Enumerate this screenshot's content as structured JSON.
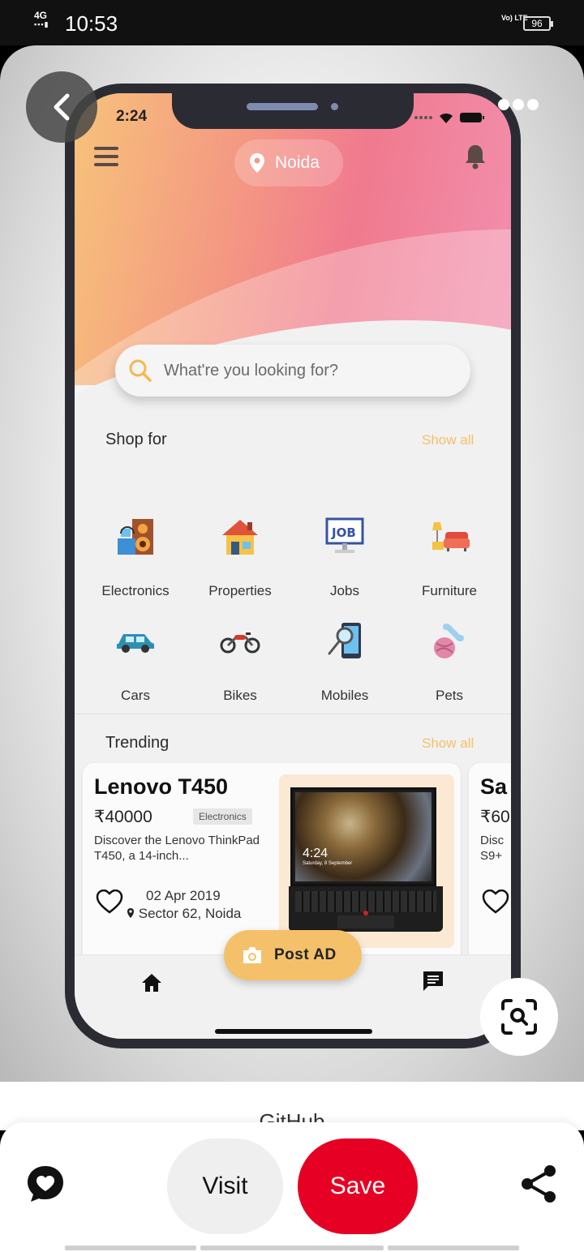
{
  "status_bar": {
    "network": "4G",
    "time": "10:53",
    "volte": "Vo) LTE",
    "battery": "96"
  },
  "pin": {
    "title": "GitHub",
    "visit_label": "Visit",
    "save_label": "Save"
  },
  "app": {
    "ios_time": "2:24",
    "location": "Noida",
    "search_placeholder": "What're you looking for?",
    "shop_title": "Shop for",
    "show_all": "Show all",
    "categories": [
      {
        "label": "Electronics",
        "icon": "electronics-icon"
      },
      {
        "label": "Properties",
        "icon": "house-icon"
      },
      {
        "label": "Jobs",
        "icon": "job-board-icon"
      },
      {
        "label": "Furniture",
        "icon": "sofa-icon"
      },
      {
        "label": "Cars",
        "icon": "car-icon"
      },
      {
        "label": "Bikes",
        "icon": "motorbike-icon"
      },
      {
        "label": "Mobiles",
        "icon": "mobile-search-icon"
      },
      {
        "label": "Pets",
        "icon": "pet-toy-icon"
      }
    ],
    "trending_title": "Trending",
    "trending": [
      {
        "title": "Lenovo T450",
        "price": "₹40000",
        "tag": "Electronics",
        "desc": "Discover the Lenovo ThinkPad T450, a 14-inch...",
        "date": "02 Apr 2019",
        "place": "Sector 62, Noida",
        "screen_time": "4:24",
        "screen_date": "Saturday, 8 September"
      },
      {
        "title": "Sa",
        "price": "₹60",
        "desc": "Disc S9+"
      }
    ],
    "post_ad_label": "Post AD"
  },
  "colors": {
    "accent": "#f4c16a",
    "save": "#e60023"
  }
}
